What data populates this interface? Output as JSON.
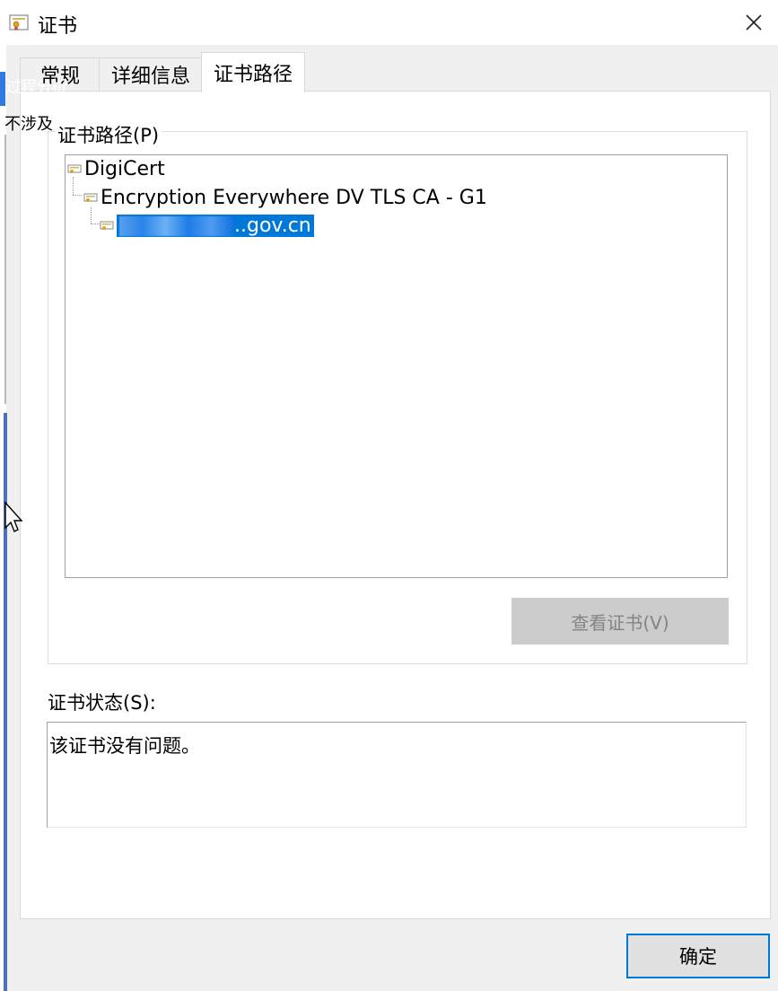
{
  "window": {
    "title": "证书",
    "close_glyph": "✕"
  },
  "overlay": {
    "line1": "过程分析",
    "line2": "不涉及"
  },
  "tabs": [
    {
      "label": "常规",
      "active": false
    },
    {
      "label": "详细信息",
      "active": false
    },
    {
      "label": "证书路径",
      "active": true
    }
  ],
  "cert_path": {
    "group_label": "证书路径(P)",
    "nodes": [
      {
        "label": "DigiCert",
        "level": 0,
        "selected": false,
        "icon": "certificate-icon"
      },
      {
        "label": "Encryption Everywhere DV TLS CA - G1",
        "level": 1,
        "selected": false,
        "icon": "certificate-icon"
      },
      {
        "label": "..gov.cn",
        "level": 2,
        "selected": true,
        "icon": "certificate-icon"
      }
    ],
    "view_button": "查看证书(V)"
  },
  "status": {
    "label": "证书状态(S):",
    "text": "该证书没有问题。"
  },
  "ok_button": "确定",
  "colors": {
    "selection": "#0078d7",
    "focus_border": "#0078d7",
    "disabled_button": "#cccccc"
  }
}
